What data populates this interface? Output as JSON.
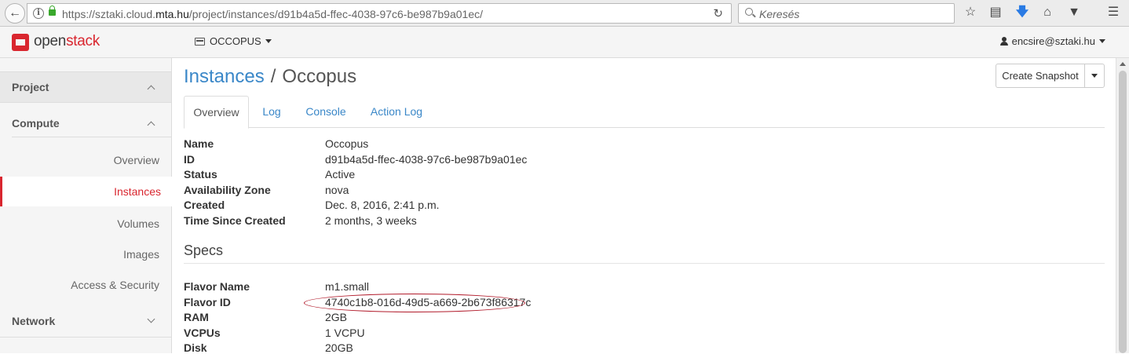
{
  "browser": {
    "url_prefix": "https://sztaki.cloud.",
    "url_domain": "mta.hu",
    "url_path": "/project/instances/d91b4a5d-ffec-4038-97c6-be987b9a01ec/",
    "search_placeholder": "Keresés",
    "icons": [
      "back-arrow",
      "info",
      "lock",
      "reload",
      "search",
      "bookmark-star",
      "reading-list",
      "download-arrow",
      "home",
      "pocket",
      "menu"
    ]
  },
  "header": {
    "logo_prefix": "open",
    "logo_suffix": "stack",
    "project": "OCCOPUS",
    "user": "encsire@sztaki.hu"
  },
  "sidebar": {
    "project_label": "Project",
    "compute_label": "Compute",
    "items": [
      {
        "label": "Overview"
      },
      {
        "label": "Instances",
        "active": true
      },
      {
        "label": "Volumes"
      },
      {
        "label": "Images"
      },
      {
        "label": "Access & Security"
      }
    ],
    "network_label": "Network"
  },
  "main": {
    "breadcrumb_parent": "Instances",
    "breadcrumb_sep": "/",
    "breadcrumb_current": "Occopus",
    "snapshot_button": "Create Snapshot",
    "tabs": [
      {
        "label": "Overview",
        "active": true
      },
      {
        "label": "Log"
      },
      {
        "label": "Console"
      },
      {
        "label": "Action Log"
      }
    ],
    "overview": [
      {
        "label": "Name",
        "value": "Occopus"
      },
      {
        "label": "ID",
        "value": "d91b4a5d-ffec-4038-97c6-be987b9a01ec"
      },
      {
        "label": "Status",
        "value": "Active"
      },
      {
        "label": "Availability Zone",
        "value": "nova"
      },
      {
        "label": "Created",
        "value": "Dec. 8, 2016, 2:41 p.m."
      },
      {
        "label": "Time Since Created",
        "value": "2 months, 3 weeks"
      }
    ],
    "specs_title": "Specs",
    "specs": [
      {
        "label": "Flavor Name",
        "value": "m1.small"
      },
      {
        "label": "Flavor ID",
        "value": "4740c1b8-016d-49d5-a669-2b673f86317c"
      },
      {
        "label": "RAM",
        "value": "2GB"
      },
      {
        "label": "VCPUs",
        "value": "1 VCPU"
      },
      {
        "label": "Disk",
        "value": "20GB"
      }
    ]
  },
  "colors": {
    "brand_red": "#d9262f",
    "link_blue": "#3a87c8",
    "annotation_red": "#b11a2a"
  }
}
